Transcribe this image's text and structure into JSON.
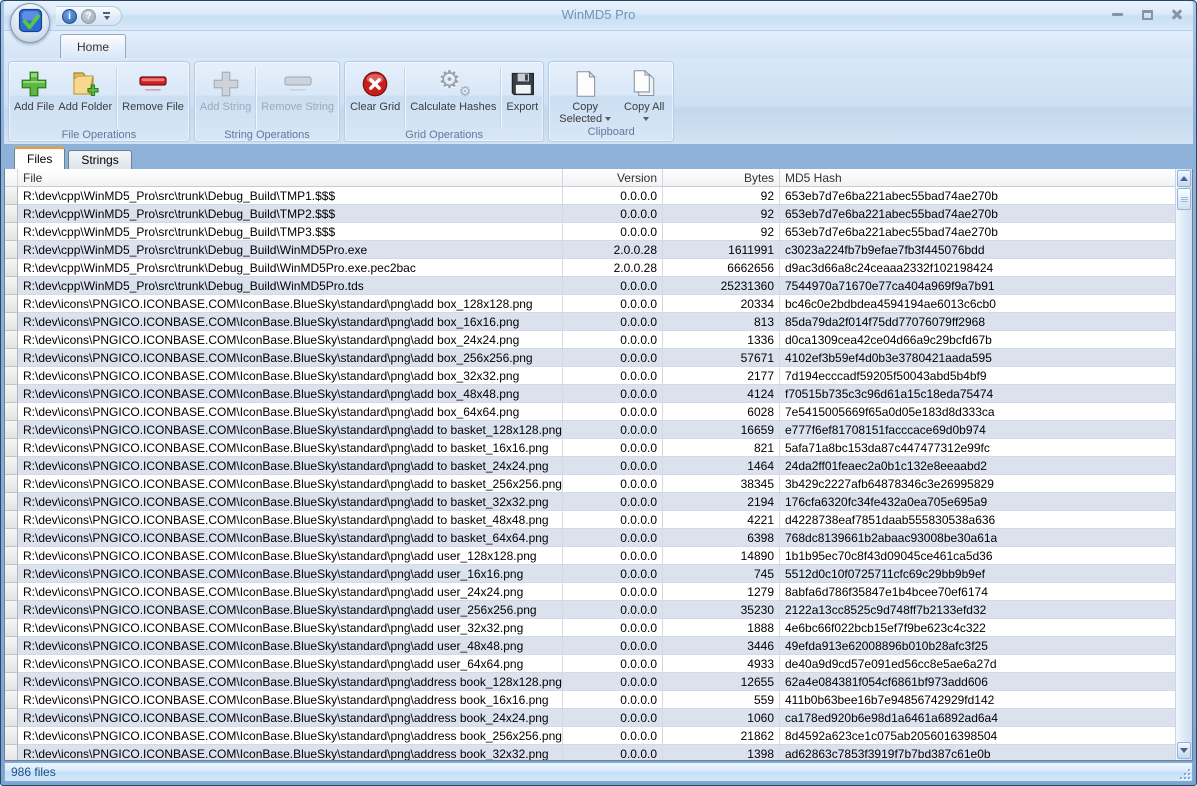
{
  "window": {
    "title": "WinMD5 Pro"
  },
  "colors": {
    "frame_blue": "#8fb2da",
    "ribbon_bg": "#d9e8f8",
    "group_border": "#b7cce4",
    "active_tab_accent": "#f49c21",
    "alt_row": "#dce2ed",
    "status_text": "#1c4d8c",
    "add_green": "#5cb842",
    "remove_red": "#cf2020",
    "disabled_gray": "#c2c9d1"
  },
  "icons": {
    "gear_glyph": "⚙",
    "info_glyph": "i",
    "help_glyph": "?",
    "app_icon": "blue-square-green-check",
    "quick_access": [
      "info-icon",
      "help-icon",
      "qat-dropdown-icon"
    ]
  },
  "ribbon": {
    "tabs": [
      {
        "label": "Home",
        "active": true
      }
    ],
    "groups": [
      {
        "title": "File Operations",
        "buttons": [
          {
            "label": "Add File",
            "icon": "green-plus-icon",
            "enabled": true
          },
          {
            "label": "Add Folder",
            "icon": "folder-plus-icon",
            "enabled": true
          },
          {
            "label": "Remove File",
            "icon": "red-minus-icon",
            "enabled": true
          }
        ]
      },
      {
        "title": "String Operations",
        "buttons": [
          {
            "label": "Add String",
            "icon": "gray-plus-icon",
            "enabled": false
          },
          {
            "label": "Remove String",
            "icon": "gray-minus-icon",
            "enabled": false
          }
        ]
      },
      {
        "title": "Grid Operations",
        "buttons": [
          {
            "label": "Clear Grid",
            "icon": "red-circle-x-icon",
            "enabled": true
          },
          {
            "label": "Calculate Hashes",
            "icon": "gears-icon",
            "enabled": true
          },
          {
            "label": "Export",
            "icon": "floppy-disk-icon",
            "enabled": true
          }
        ]
      },
      {
        "title": "Clipboard",
        "buttons": [
          {
            "label": "Copy Selected",
            "icon": "copy-page-icon",
            "enabled": true,
            "dropdown": true
          },
          {
            "label": "Copy All",
            "icon": "copy-pages-icon",
            "enabled": true,
            "dropdown": true
          }
        ]
      }
    ]
  },
  "view_tabs": [
    {
      "label": "Files",
      "active": true
    },
    {
      "label": "Strings",
      "active": false
    }
  ],
  "table": {
    "columns": [
      "File",
      "Version",
      "Bytes",
      "MD5 Hash"
    ],
    "rows": [
      [
        "R:\\dev\\cpp\\WinMD5_Pro\\src\\trunk\\Debug_Build\\TMP1.$$$",
        "0.0.0.0",
        "92",
        "653eb7d7e6ba221abec55bad74ae270b"
      ],
      [
        "R:\\dev\\cpp\\WinMD5_Pro\\src\\trunk\\Debug_Build\\TMP2.$$$",
        "0.0.0.0",
        "92",
        "653eb7d7e6ba221abec55bad74ae270b"
      ],
      [
        "R:\\dev\\cpp\\WinMD5_Pro\\src\\trunk\\Debug_Build\\TMP3.$$$",
        "0.0.0.0",
        "92",
        "653eb7d7e6ba221abec55bad74ae270b"
      ],
      [
        "R:\\dev\\cpp\\WinMD5_Pro\\src\\trunk\\Debug_Build\\WinMD5Pro.exe",
        "2.0.0.28",
        "1611991",
        "c3023a224fb7b9efae7fb3f445076bdd"
      ],
      [
        "R:\\dev\\cpp\\WinMD5_Pro\\src\\trunk\\Debug_Build\\WinMD5Pro.exe.pec2bac",
        "2.0.0.28",
        "6662656",
        "d9ac3d66a8c24ceaaa2332f102198424"
      ],
      [
        "R:\\dev\\cpp\\WinMD5_Pro\\src\\trunk\\Debug_Build\\WinMD5Pro.tds",
        "0.0.0.0",
        "25231360",
        "7544970a71670e77ca404a969f9a7b91"
      ],
      [
        "R:\\dev\\icons\\PNGICO.ICONBASE.COM\\IconBase.BlueSky\\standard\\png\\add box_128x128.png",
        "0.0.0.0",
        "20334",
        "bc46c0e2bdbdea4594194ae6013c6cb0"
      ],
      [
        "R:\\dev\\icons\\PNGICO.ICONBASE.COM\\IconBase.BlueSky\\standard\\png\\add box_16x16.png",
        "0.0.0.0",
        "813",
        "85da79da2f014f75dd77076079ff2968"
      ],
      [
        "R:\\dev\\icons\\PNGICO.ICONBASE.COM\\IconBase.BlueSky\\standard\\png\\add box_24x24.png",
        "0.0.0.0",
        "1336",
        "d0ca1309cea42ce04d66a9c29bcfd67b"
      ],
      [
        "R:\\dev\\icons\\PNGICO.ICONBASE.COM\\IconBase.BlueSky\\standard\\png\\add box_256x256.png",
        "0.0.0.0",
        "57671",
        "4102ef3b59ef4d0b3e3780421aada595"
      ],
      [
        "R:\\dev\\icons\\PNGICO.ICONBASE.COM\\IconBase.BlueSky\\standard\\png\\add box_32x32.png",
        "0.0.0.0",
        "2177",
        "7d194ecccadf59205f50043abd5b4bf9"
      ],
      [
        "R:\\dev\\icons\\PNGICO.ICONBASE.COM\\IconBase.BlueSky\\standard\\png\\add box_48x48.png",
        "0.0.0.0",
        "4124",
        "f70515b735c3c96d61a15c18eda75474"
      ],
      [
        "R:\\dev\\icons\\PNGICO.ICONBASE.COM\\IconBase.BlueSky\\standard\\png\\add box_64x64.png",
        "0.0.0.0",
        "6028",
        "7e5415005669f65a0d05e183d8d333ca"
      ],
      [
        "R:\\dev\\icons\\PNGICO.ICONBASE.COM\\IconBase.BlueSky\\standard\\png\\add to basket_128x128.png",
        "0.0.0.0",
        "16659",
        "e777f6ef81708151facccace69d0b974"
      ],
      [
        "R:\\dev\\icons\\PNGICO.ICONBASE.COM\\IconBase.BlueSky\\standard\\png\\add to basket_16x16.png",
        "0.0.0.0",
        "821",
        "5afa71a8bc153da87c447477312e99fc"
      ],
      [
        "R:\\dev\\icons\\PNGICO.ICONBASE.COM\\IconBase.BlueSky\\standard\\png\\add to basket_24x24.png",
        "0.0.0.0",
        "1464",
        "24da2ff01feaec2a0b1c132e8eeaabd2"
      ],
      [
        "R:\\dev\\icons\\PNGICO.ICONBASE.COM\\IconBase.BlueSky\\standard\\png\\add to basket_256x256.png",
        "0.0.0.0",
        "38345",
        "3b429c2227afb64878346c3e26995829"
      ],
      [
        "R:\\dev\\icons\\PNGICO.ICONBASE.COM\\IconBase.BlueSky\\standard\\png\\add to basket_32x32.png",
        "0.0.0.0",
        "2194",
        "176cfa6320fc34fe432a0ea705e695a9"
      ],
      [
        "R:\\dev\\icons\\PNGICO.ICONBASE.COM\\IconBase.BlueSky\\standard\\png\\add to basket_48x48.png",
        "0.0.0.0",
        "4221",
        "d4228738eaf7851daab555830538a636"
      ],
      [
        "R:\\dev\\icons\\PNGICO.ICONBASE.COM\\IconBase.BlueSky\\standard\\png\\add to basket_64x64.png",
        "0.0.0.0",
        "6398",
        "768dc8139661b2abaac93008be30a61a"
      ],
      [
        "R:\\dev\\icons\\PNGICO.ICONBASE.COM\\IconBase.BlueSky\\standard\\png\\add user_128x128.png",
        "0.0.0.0",
        "14890",
        "1b1b95ec70c8f43d09045ce461ca5d36"
      ],
      [
        "R:\\dev\\icons\\PNGICO.ICONBASE.COM\\IconBase.BlueSky\\standard\\png\\add user_16x16.png",
        "0.0.0.0",
        "745",
        "5512d0c10f0725711cfc69c29bb9b9ef"
      ],
      [
        "R:\\dev\\icons\\PNGICO.ICONBASE.COM\\IconBase.BlueSky\\standard\\png\\add user_24x24.png",
        "0.0.0.0",
        "1279",
        "8abfa6d786f35847e1b4bcee70ef6174"
      ],
      [
        "R:\\dev\\icons\\PNGICO.ICONBASE.COM\\IconBase.BlueSky\\standard\\png\\add user_256x256.png",
        "0.0.0.0",
        "35230",
        "2122a13cc8525c9d748ff7b2133efd32"
      ],
      [
        "R:\\dev\\icons\\PNGICO.ICONBASE.COM\\IconBase.BlueSky\\standard\\png\\add user_32x32.png",
        "0.0.0.0",
        "1888",
        "4e6bc66f022bcb15ef7f9be623c4c322"
      ],
      [
        "R:\\dev\\icons\\PNGICO.ICONBASE.COM\\IconBase.BlueSky\\standard\\png\\add user_48x48.png",
        "0.0.0.0",
        "3446",
        "49efda913e62008896b010b28afc3f25"
      ],
      [
        "R:\\dev\\icons\\PNGICO.ICONBASE.COM\\IconBase.BlueSky\\standard\\png\\add user_64x64.png",
        "0.0.0.0",
        "4933",
        "de40a9d9cd57e091ed56cc8e5ae6a27d"
      ],
      [
        "R:\\dev\\icons\\PNGICO.ICONBASE.COM\\IconBase.BlueSky\\standard\\png\\address book_128x128.png",
        "0.0.0.0",
        "12655",
        "62a4e084381f054cf6861bf973add606"
      ],
      [
        "R:\\dev\\icons\\PNGICO.ICONBASE.COM\\IconBase.BlueSky\\standard\\png\\address book_16x16.png",
        "0.0.0.0",
        "559",
        "411b0b63bee16b7e94856742929fd142"
      ],
      [
        "R:\\dev\\icons\\PNGICO.ICONBASE.COM\\IconBase.BlueSky\\standard\\png\\address book_24x24.png",
        "0.0.0.0",
        "1060",
        "ca178ed920b6e98d1a6461a6892ad6a4"
      ],
      [
        "R:\\dev\\icons\\PNGICO.ICONBASE.COM\\IconBase.BlueSky\\standard\\png\\address book_256x256.png",
        "0.0.0.0",
        "21862",
        "8d4592a623ce1c075ab2056016398504"
      ],
      [
        "R:\\dev\\icons\\PNGICO.ICONBASE.COM\\IconBase.BlueSky\\standard\\png\\address book_32x32.png",
        "0.0.0.0",
        "1398",
        "ad62863c7853f3919f7b7bd387c61e0b"
      ]
    ]
  },
  "status": {
    "files_text": "986 files"
  }
}
